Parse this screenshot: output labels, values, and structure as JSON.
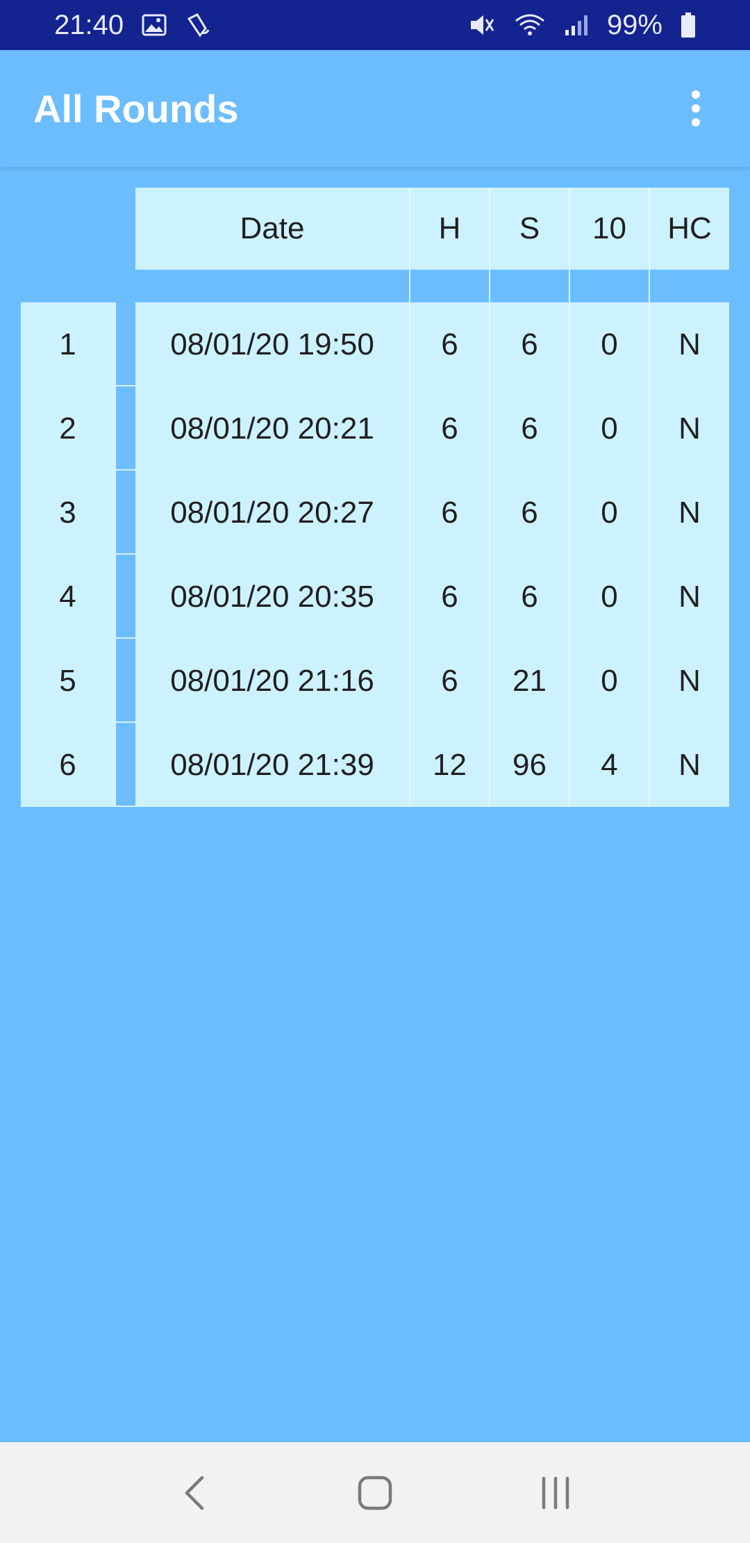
{
  "status_bar": {
    "time": "21:40",
    "battery": "99%",
    "icons": [
      "image-icon",
      "vibrate-signal-icon",
      "mute-icon",
      "wifi-icon",
      "cell-signal-icon",
      "battery-icon"
    ]
  },
  "app_bar": {
    "title": "All Rounds",
    "overflow_icon": "more-vert-icon"
  },
  "table": {
    "headers": [
      "Date",
      "H",
      "S",
      "10",
      "HC"
    ],
    "rows": [
      {
        "index": "1",
        "date": "08/01/20 19:50",
        "h": "6",
        "s": "6",
        "ten": "0",
        "hc": "N"
      },
      {
        "index": "2",
        "date": "08/01/20 20:21",
        "h": "6",
        "s": "6",
        "ten": "0",
        "hc": "N"
      },
      {
        "index": "3",
        "date": "08/01/20 20:27",
        "h": "6",
        "s": "6",
        "ten": "0",
        "hc": "N"
      },
      {
        "index": "4",
        "date": "08/01/20 20:35",
        "h": "6",
        "s": "6",
        "ten": "0",
        "hc": "N"
      },
      {
        "index": "5",
        "date": "08/01/20 21:16",
        "h": "6",
        "s": "21",
        "ten": "0",
        "hc": "N"
      },
      {
        "index": "6",
        "date": "08/01/20 21:39",
        "h": "12",
        "s": "96",
        "ten": "4",
        "hc": "N"
      }
    ]
  },
  "nav_bar": {
    "buttons": [
      "back-icon",
      "home-icon",
      "recents-icon"
    ]
  },
  "colors": {
    "status_bar_bg": "#13238f",
    "app_bg": "#6bbdfe",
    "cell_bg": "#cdf2ff",
    "nav_bg": "#f2f2f2"
  }
}
